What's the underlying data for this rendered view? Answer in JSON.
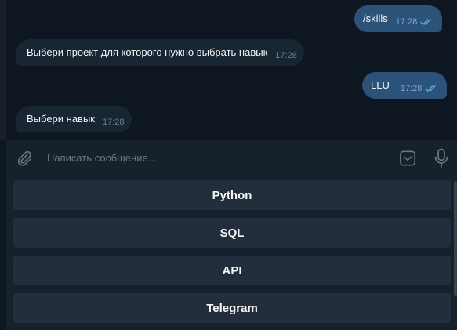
{
  "messages": [
    {
      "direction": "out",
      "text": "/skills",
      "time": "17:28",
      "status": "read"
    },
    {
      "direction": "in",
      "text": "Выбери проект для которого нужно выбрать навык",
      "time": "17:28"
    },
    {
      "direction": "out",
      "text": "LLU",
      "time": "17:28",
      "status": "read"
    },
    {
      "direction": "in",
      "text": "Выбери навык",
      "time": "17:28"
    }
  ],
  "composer": {
    "placeholder": "Написать сообщение...",
    "value": ""
  },
  "keyboard": {
    "buttons": [
      "Python",
      "SQL",
      "API",
      "Telegram"
    ]
  },
  "colors": {
    "chat_background": "#0e1621",
    "incoming_bubble": "#182533",
    "outgoing_bubble": "#2b5278",
    "panel": "#17212b",
    "keyboard_button": "#232e3c",
    "read_ticks": "#5fa8e8"
  },
  "icons": {
    "attach": "paperclip-icon",
    "keyboard": "bot-keyboard-icon",
    "mic": "microphone-icon",
    "read": "double-check-icon"
  }
}
